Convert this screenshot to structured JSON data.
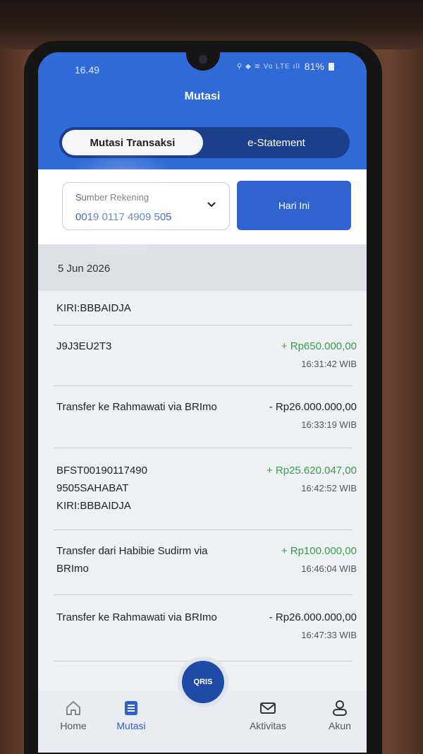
{
  "status_bar": {
    "time": "16.49",
    "icons": "⚲ ◆ ≋ Vo LTE ıll",
    "battery": "81%"
  },
  "header": {
    "title": "Mutasi"
  },
  "tabs": {
    "active": "Mutasi Transaksi",
    "inactive": "e-Statement"
  },
  "filter": {
    "account_label": "Sumber Rekening",
    "account_number": "0019 0117 4909 505",
    "date_button": "Hari Ini"
  },
  "date_header": "5 Jun 2026",
  "transactions": [
    {
      "desc": "KIRI:BBBAIDJA",
      "amount": "",
      "time": ""
    },
    {
      "desc": "J9J3EU2T3",
      "amount": "+ Rp650.000,00",
      "time": "16:31:42 WIB"
    },
    {
      "desc": "Transfer ke Rahmawati via BRImo",
      "amount": "- Rp26.000.000,00",
      "time": "16:33:19 WIB"
    },
    {
      "desc": "BFST00190117490 9505SAHABAT KIRI:BBBAIDJA",
      "amount": "+ Rp25.620.047,00",
      "time": "16:42:52 WIB"
    },
    {
      "desc": "Transfer dari Habibie Sudirm via BRImo",
      "amount": "+ Rp100.000,00",
      "time": "16:46:04 WIB"
    },
    {
      "desc": "Transfer ke Rahmawati via BRImo",
      "amount": "- Rp26.000.000,00",
      "time": "16:47:33 WIB"
    }
  ],
  "nav": {
    "home": "Home",
    "mutasi": "Mutasi",
    "qris": "QRIS",
    "aktivitas": "Aktivitas",
    "akun": "Akun"
  },
  "colors": {
    "brand_blue": "#2f6ad6",
    "credit_green": "#3a9a4a"
  }
}
